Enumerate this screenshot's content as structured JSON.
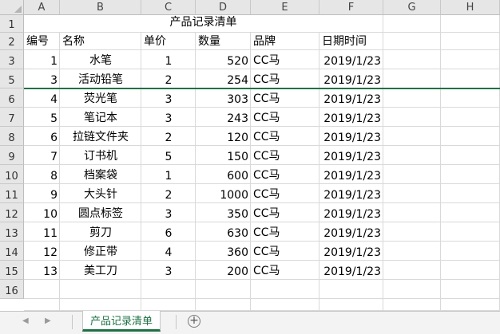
{
  "spreadsheet": {
    "columns": [
      "A",
      "B",
      "C",
      "D",
      "E",
      "F",
      "G",
      "H"
    ],
    "rows": [
      "1",
      "2",
      "3",
      "5",
      "6",
      "7",
      "8",
      "9",
      "10",
      "11",
      "12",
      "13",
      "14",
      "15",
      "16"
    ],
    "title": "产品记录清单",
    "headers": [
      "编号",
      "名称",
      "单价",
      "数量",
      "品牌",
      "日期时间"
    ],
    "records": [
      [
        "1",
        "水笔",
        "1",
        "520",
        "CC马",
        "2019/1/23"
      ],
      [
        "3",
        "活动铅笔",
        "2",
        "254",
        "CC马",
        "2019/1/23"
      ],
      [
        "4",
        "荧光笔",
        "3",
        "303",
        "CC马",
        "2019/1/23"
      ],
      [
        "5",
        "笔记本",
        "3",
        "243",
        "CC马",
        "2019/1/23"
      ],
      [
        "6",
        "拉链文件夹",
        "2",
        "120",
        "CC马",
        "2019/1/23"
      ],
      [
        "7",
        "订书机",
        "5",
        "150",
        "CC马",
        "2019/1/23"
      ],
      [
        "8",
        "档案袋",
        "1",
        "600",
        "CC马",
        "2019/1/23"
      ],
      [
        "9",
        "大头针",
        "2",
        "1000",
        "CC马",
        "2019/1/23"
      ],
      [
        "10",
        "圆点标签",
        "3",
        "350",
        "CC马",
        "2019/1/23"
      ],
      [
        "11",
        "剪刀",
        "6",
        "630",
        "CC马",
        "2019/1/23"
      ],
      [
        "12",
        "修正带",
        "4",
        "360",
        "CC马",
        "2019/1/23"
      ],
      [
        "13",
        "美工刀",
        "3",
        "200",
        "CC马",
        "2019/1/23"
      ]
    ]
  },
  "sheet_tabs": {
    "active": "产品记录清单",
    "add_icon": "plus-circle-icon"
  },
  "colors": {
    "accent": "#1e7145",
    "header_bg": "#e6e6e6",
    "grid": "#d9d9d9"
  }
}
